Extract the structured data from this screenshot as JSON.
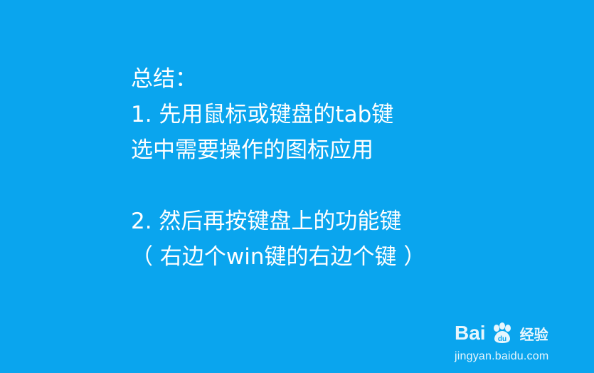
{
  "slide": {
    "lines": [
      "总结：",
      "1. 先用鼠标或键盘的tab键",
      "选中需要操作的图标应用",
      "",
      "2. 然后再按键盘上的功能键",
      "（ 右边个win键的右边个键 ）"
    ]
  },
  "watermark": {
    "brand_left": "Bai",
    "brand_right": "经验",
    "url": "jingyan.baidu.com",
    "icon_name": "baidu-paw-icon"
  },
  "colors": {
    "background": "#0aa5ee",
    "text": "#ffffff"
  }
}
